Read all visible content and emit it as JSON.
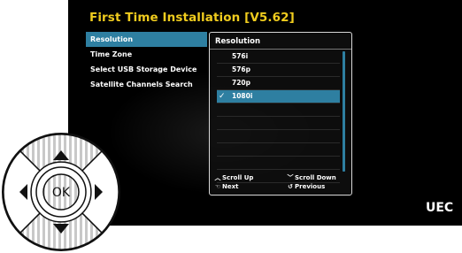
{
  "screen": {
    "title": "First Time Installation [V5.62]",
    "menu": [
      {
        "label": "Resolution",
        "selected": true
      },
      {
        "label": "Time Zone",
        "selected": false
      },
      {
        "label": "Select USB Storage Device",
        "selected": false
      },
      {
        "label": "Satellite Channels Search",
        "selected": false
      }
    ],
    "panel": {
      "title": "Resolution",
      "options": [
        {
          "label": "576i",
          "selected": false
        },
        {
          "label": "576p",
          "selected": false
        },
        {
          "label": "720p",
          "selected": false
        },
        {
          "label": "1080i",
          "selected": true
        },
        {
          "label": "",
          "selected": false
        },
        {
          "label": "",
          "selected": false
        },
        {
          "label": "",
          "selected": false
        },
        {
          "label": "",
          "selected": false
        },
        {
          "label": "",
          "selected": false
        },
        {
          "label": "",
          "selected": false
        }
      ],
      "check_mark": "✓",
      "hints": {
        "scroll_up": "Scroll Up",
        "scroll_down": "Scroll Down",
        "next": "Next",
        "previous": "Previous"
      }
    },
    "logo": "UEC"
  },
  "remote": {
    "center_label": "OK",
    "icons": [
      "arrow-up-icon",
      "arrow-down-icon",
      "arrow-left-icon",
      "arrow-right-icon"
    ]
  },
  "colors": {
    "accent": "#2e7fa1",
    "title": "#f0cc1e",
    "background": "#000000"
  }
}
